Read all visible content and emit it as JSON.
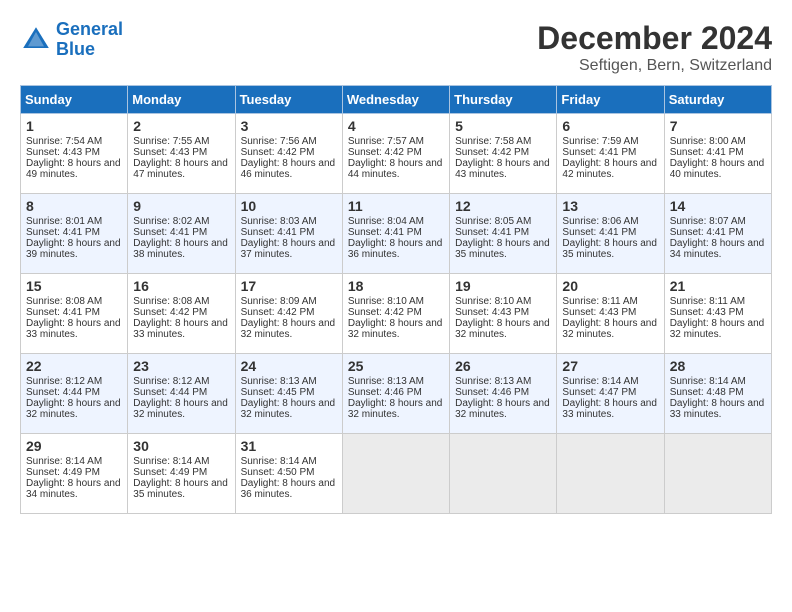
{
  "header": {
    "logo_line1": "General",
    "logo_line2": "Blue",
    "month_title": "December 2024",
    "subtitle": "Seftigen, Bern, Switzerland"
  },
  "days_of_week": [
    "Sunday",
    "Monday",
    "Tuesday",
    "Wednesday",
    "Thursday",
    "Friday",
    "Saturday"
  ],
  "weeks": [
    [
      {
        "day": "1",
        "sunrise": "Sunrise: 7:54 AM",
        "sunset": "Sunset: 4:43 PM",
        "daylight": "Daylight: 8 hours and 49 minutes."
      },
      {
        "day": "2",
        "sunrise": "Sunrise: 7:55 AM",
        "sunset": "Sunset: 4:43 PM",
        "daylight": "Daylight: 8 hours and 47 minutes."
      },
      {
        "day": "3",
        "sunrise": "Sunrise: 7:56 AM",
        "sunset": "Sunset: 4:42 PM",
        "daylight": "Daylight: 8 hours and 46 minutes."
      },
      {
        "day": "4",
        "sunrise": "Sunrise: 7:57 AM",
        "sunset": "Sunset: 4:42 PM",
        "daylight": "Daylight: 8 hours and 44 minutes."
      },
      {
        "day": "5",
        "sunrise": "Sunrise: 7:58 AM",
        "sunset": "Sunset: 4:42 PM",
        "daylight": "Daylight: 8 hours and 43 minutes."
      },
      {
        "day": "6",
        "sunrise": "Sunrise: 7:59 AM",
        "sunset": "Sunset: 4:41 PM",
        "daylight": "Daylight: 8 hours and 42 minutes."
      },
      {
        "day": "7",
        "sunrise": "Sunrise: 8:00 AM",
        "sunset": "Sunset: 4:41 PM",
        "daylight": "Daylight: 8 hours and 40 minutes."
      }
    ],
    [
      {
        "day": "8",
        "sunrise": "Sunrise: 8:01 AM",
        "sunset": "Sunset: 4:41 PM",
        "daylight": "Daylight: 8 hours and 39 minutes."
      },
      {
        "day": "9",
        "sunrise": "Sunrise: 8:02 AM",
        "sunset": "Sunset: 4:41 PM",
        "daylight": "Daylight: 8 hours and 38 minutes."
      },
      {
        "day": "10",
        "sunrise": "Sunrise: 8:03 AM",
        "sunset": "Sunset: 4:41 PM",
        "daylight": "Daylight: 8 hours and 37 minutes."
      },
      {
        "day": "11",
        "sunrise": "Sunrise: 8:04 AM",
        "sunset": "Sunset: 4:41 PM",
        "daylight": "Daylight: 8 hours and 36 minutes."
      },
      {
        "day": "12",
        "sunrise": "Sunrise: 8:05 AM",
        "sunset": "Sunset: 4:41 PM",
        "daylight": "Daylight: 8 hours and 35 minutes."
      },
      {
        "day": "13",
        "sunrise": "Sunrise: 8:06 AM",
        "sunset": "Sunset: 4:41 PM",
        "daylight": "Daylight: 8 hours and 35 minutes."
      },
      {
        "day": "14",
        "sunrise": "Sunrise: 8:07 AM",
        "sunset": "Sunset: 4:41 PM",
        "daylight": "Daylight: 8 hours and 34 minutes."
      }
    ],
    [
      {
        "day": "15",
        "sunrise": "Sunrise: 8:08 AM",
        "sunset": "Sunset: 4:41 PM",
        "daylight": "Daylight: 8 hours and 33 minutes."
      },
      {
        "day": "16",
        "sunrise": "Sunrise: 8:08 AM",
        "sunset": "Sunset: 4:42 PM",
        "daylight": "Daylight: 8 hours and 33 minutes."
      },
      {
        "day": "17",
        "sunrise": "Sunrise: 8:09 AM",
        "sunset": "Sunset: 4:42 PM",
        "daylight": "Daylight: 8 hours and 32 minutes."
      },
      {
        "day": "18",
        "sunrise": "Sunrise: 8:10 AM",
        "sunset": "Sunset: 4:42 PM",
        "daylight": "Daylight: 8 hours and 32 minutes."
      },
      {
        "day": "19",
        "sunrise": "Sunrise: 8:10 AM",
        "sunset": "Sunset: 4:43 PM",
        "daylight": "Daylight: 8 hours and 32 minutes."
      },
      {
        "day": "20",
        "sunrise": "Sunrise: 8:11 AM",
        "sunset": "Sunset: 4:43 PM",
        "daylight": "Daylight: 8 hours and 32 minutes."
      },
      {
        "day": "21",
        "sunrise": "Sunrise: 8:11 AM",
        "sunset": "Sunset: 4:43 PM",
        "daylight": "Daylight: 8 hours and 32 minutes."
      }
    ],
    [
      {
        "day": "22",
        "sunrise": "Sunrise: 8:12 AM",
        "sunset": "Sunset: 4:44 PM",
        "daylight": "Daylight: 8 hours and 32 minutes."
      },
      {
        "day": "23",
        "sunrise": "Sunrise: 8:12 AM",
        "sunset": "Sunset: 4:44 PM",
        "daylight": "Daylight: 8 hours and 32 minutes."
      },
      {
        "day": "24",
        "sunrise": "Sunrise: 8:13 AM",
        "sunset": "Sunset: 4:45 PM",
        "daylight": "Daylight: 8 hours and 32 minutes."
      },
      {
        "day": "25",
        "sunrise": "Sunrise: 8:13 AM",
        "sunset": "Sunset: 4:46 PM",
        "daylight": "Daylight: 8 hours and 32 minutes."
      },
      {
        "day": "26",
        "sunrise": "Sunrise: 8:13 AM",
        "sunset": "Sunset: 4:46 PM",
        "daylight": "Daylight: 8 hours and 32 minutes."
      },
      {
        "day": "27",
        "sunrise": "Sunrise: 8:14 AM",
        "sunset": "Sunset: 4:47 PM",
        "daylight": "Daylight: 8 hours and 33 minutes."
      },
      {
        "day": "28",
        "sunrise": "Sunrise: 8:14 AM",
        "sunset": "Sunset: 4:48 PM",
        "daylight": "Daylight: 8 hours and 33 minutes."
      }
    ],
    [
      {
        "day": "29",
        "sunrise": "Sunrise: 8:14 AM",
        "sunset": "Sunset: 4:49 PM",
        "daylight": "Daylight: 8 hours and 34 minutes."
      },
      {
        "day": "30",
        "sunrise": "Sunrise: 8:14 AM",
        "sunset": "Sunset: 4:49 PM",
        "daylight": "Daylight: 8 hours and 35 minutes."
      },
      {
        "day": "31",
        "sunrise": "Sunrise: 8:14 AM",
        "sunset": "Sunset: 4:50 PM",
        "daylight": "Daylight: 8 hours and 36 minutes."
      },
      null,
      null,
      null,
      null
    ]
  ]
}
